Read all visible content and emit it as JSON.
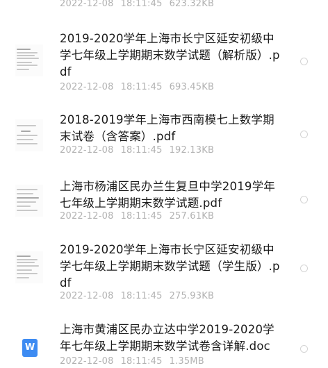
{
  "files": [
    {
      "title": "",
      "date": "2022-12-08",
      "time": "18:11:45",
      "size": "623.32KB",
      "icon": "document-thumbnail-icon"
    },
    {
      "title": "2019-2020学年上海市长宁区延安初级中学七年级上学期期末数学试题（解析版）.pdf",
      "date": "2022-12-08",
      "time": "18:11:45",
      "size": "693.45KB",
      "icon": "document-thumbnail-icon"
    },
    {
      "title": "2018-2019学年上海市西南模七上数学期末试卷（含答案）.pdf",
      "date": "2022-12-08",
      "time": "18:11:45",
      "size": "192.13KB",
      "icon": "document-thumbnail-icon"
    },
    {
      "title": "上海市杨浦区民办兰生复旦中学2019学年七年级上学期期末数学试题.pdf",
      "date": "2022-12-08",
      "time": "18:11:45",
      "size": "257.61KB",
      "icon": "document-thumbnail-icon"
    },
    {
      "title": "2019-2020学年上海市长宁区延安初级中学七年级上学期期末数学试题（学生版）.pdf",
      "date": "2022-12-08",
      "time": "18:11:45",
      "size": "275.93KB",
      "icon": "document-thumbnail-icon"
    },
    {
      "title": "上海市黄浦区民办立达中学2019-2020学年七年级上学期期末数学试卷含详解.doc",
      "date": "2022-12-08",
      "time": "18:11:45",
      "size": "1.35MB",
      "icon": "word-document-icon",
      "icon_letter": "W",
      "icon_color": "#3d8bf2"
    }
  ]
}
